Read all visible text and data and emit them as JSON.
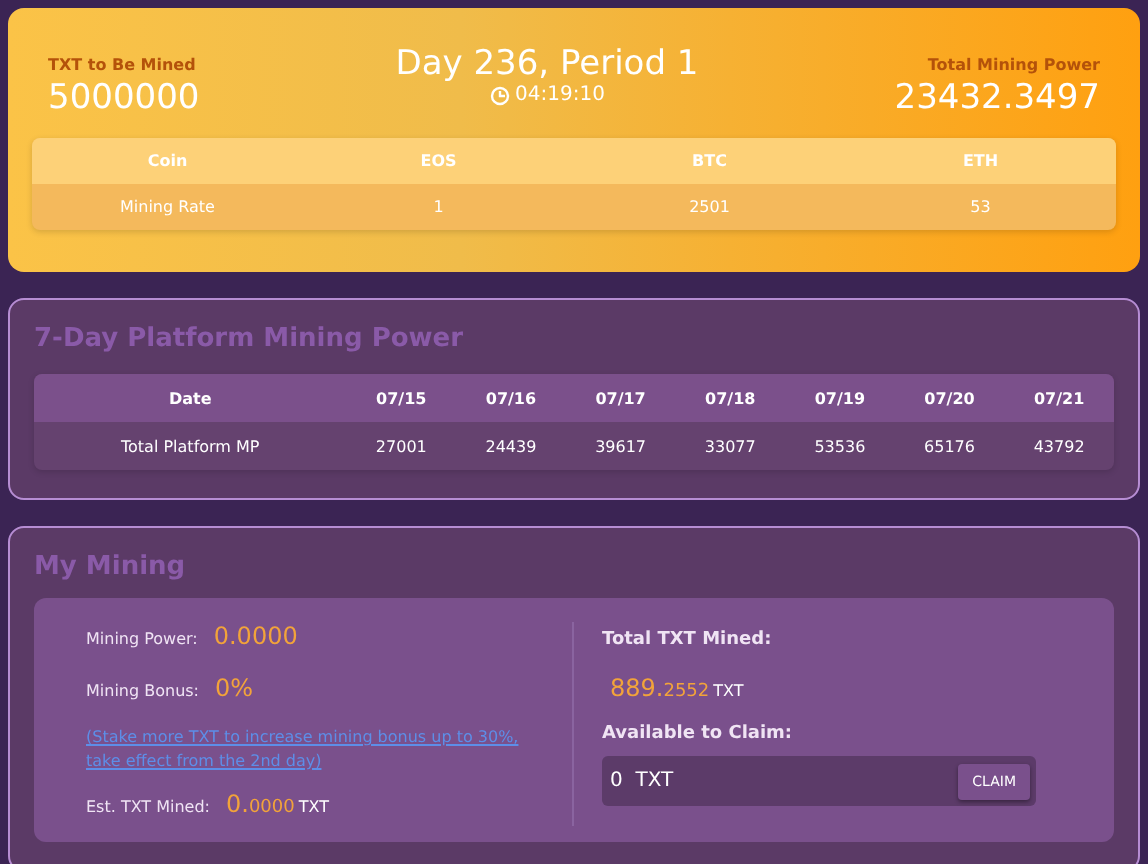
{
  "summary": {
    "to_be_mined_label": "TXT to Be Mined",
    "to_be_mined": "5000000",
    "period": "Day 236, Period 1",
    "countdown": "04:19:10",
    "total_power_label": "Total Mining Power",
    "total_power": "23432.3497"
  },
  "rate_table": {
    "columns": [
      "Coin",
      "EOS",
      "BTC",
      "ETH"
    ],
    "rows": [
      [
        "Mining Rate",
        "1",
        "2501",
        "53"
      ]
    ]
  },
  "platform": {
    "title": "7-Day Platform Mining Power",
    "columns": [
      "Date",
      "07/15",
      "07/16",
      "07/17",
      "07/18",
      "07/19",
      "07/20",
      "07/21"
    ],
    "rows": [
      [
        "Total Platform MP",
        "27001",
        "24439",
        "39617",
        "33077",
        "53536",
        "65176",
        "43792"
      ]
    ]
  },
  "my_mining": {
    "title": "My Mining",
    "power_label": "Mining Power:",
    "power": "0.0000",
    "bonus_label": "Mining Bonus:",
    "bonus": "0%",
    "stake_link": " (Stake more TXT to increase mining bonus up to 30%, take effect from the 2nd day)",
    "est_label": "Est. TXT Mined:",
    "est_int": "0.",
    "est_frac": "0000",
    "est_unit": "TXT",
    "total_label": "Total TXT Mined:",
    "total_int": "889.",
    "total_frac": "2552",
    "total_unit": "TXT",
    "claim_label": "Available to Claim:",
    "claim_value": "0  TXT",
    "claim_button": "CLAIM"
  }
}
